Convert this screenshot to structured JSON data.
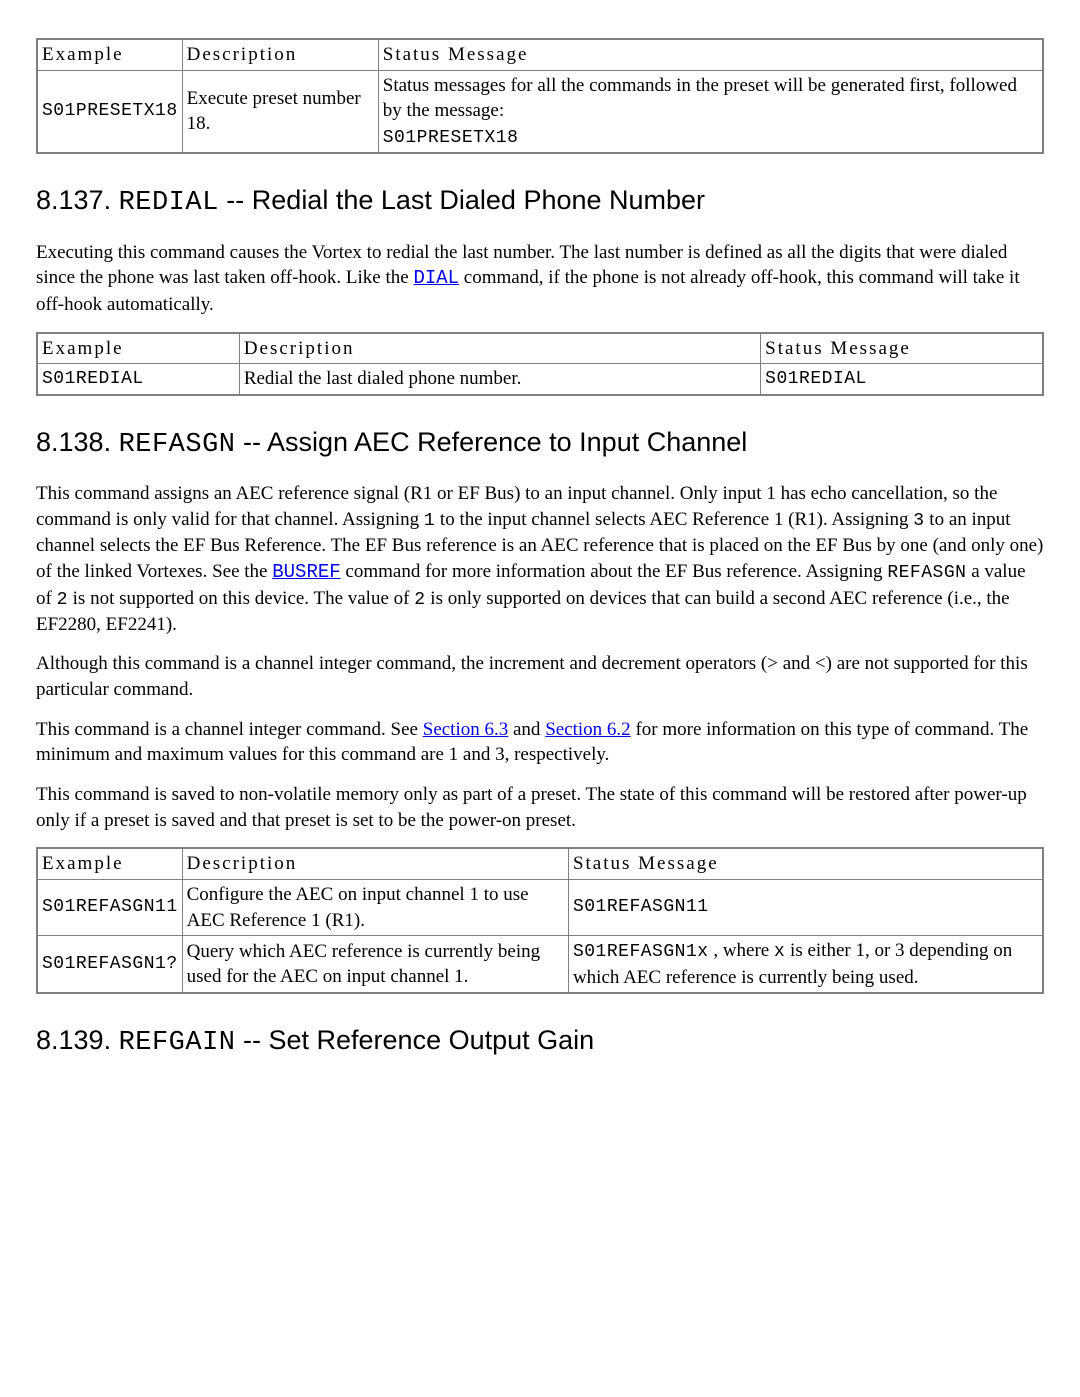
{
  "table0": {
    "headers": {
      "example": "Example",
      "description": "Description",
      "status": "Status Message"
    },
    "rows": [
      {
        "example": "S01PRESETX18",
        "description": "Execute preset number 18.",
        "status_prefix": "Status messages for all the commands in the preset will be generated first, followed by the message: ",
        "status_code": "S01PRESETX18"
      }
    ]
  },
  "section137": {
    "heading_num": "8.137. ",
    "heading_code": "REDIAL",
    "heading_rest": " -- Redial the Last Dialed Phone Number",
    "p1_a": "Executing this command causes the Vortex to redial the last number. The last number is defined as all the digits that were dialed since the phone was last taken off-hook. Like the ",
    "p1_link": "DIAL",
    "p1_b": " command, if the phone is not already off-hook, this command will take it off-hook automatically.",
    "table": {
      "headers": {
        "example": "Example",
        "description": "Description",
        "status": "Status Message"
      },
      "rows": [
        {
          "example": "S01REDIAL",
          "description": "Redial the last dialed phone number.",
          "status": "S01REDIAL"
        }
      ]
    }
  },
  "section138": {
    "heading_num": "8.138. ",
    "heading_code": "REFASGN",
    "heading_rest": " -- Assign AEC Reference to Input Channel",
    "p1_a": "This command assigns an AEC reference signal (R1 or EF Bus) to an input channel. Only input 1 has echo cancellation, so the command is only valid for that channel. Assigning ",
    "p1_code1": "1",
    "p1_b": " to the input channel selects AEC Reference 1 (R1). Assigning ",
    "p1_code2": "3",
    "p1_c": " to an input channel selects the EF Bus Reference. The EF Bus reference is an AEC reference that is placed on the EF Bus by one (and only one) of the linked Vortexes. See the ",
    "p1_link": "BUSREF",
    "p1_d": " command for more information about the EF Bus reference. Assigning ",
    "p1_code3": "REFASGN",
    "p1_e": " a value of ",
    "p1_code4": "2",
    "p1_f": " is not supported on this device. The value of ",
    "p1_code5": "2",
    "p1_g": " is only supported on devices that can build a second AEC reference (i.e., the EF2280, EF2241).",
    "p2": "Although this command is a channel integer command, the increment and decrement operators (> and <) are not supported for this particular command.",
    "p3_a": "This command is a channel integer command. See ",
    "p3_link1": "Section 6.3",
    "p3_b": " and ",
    "p3_link2": "Section 6.2",
    "p3_c": " for more information on this type of command. The minimum and maximum values for this command are 1 and 3, respectively.",
    "p4": "This command is saved to non-volatile memory only as part of a preset. The state of this command will be restored after power-up only if a preset is saved and that preset is set to be the power-on preset.",
    "table": {
      "headers": {
        "example": "Example",
        "description": "Description",
        "status": "Status Message"
      },
      "rows": [
        {
          "example": "S01REFASGN11",
          "description": "Configure the AEC on input channel 1 to use AEC Reference 1 (R1).",
          "status": "S01REFASGN11"
        },
        {
          "example": "S01REFASGN1?",
          "description": "Query which AEC reference is currently being used for the AEC on input channel 1.",
          "status_code": "S01REFASGN1x",
          "status_mid": " , where ",
          "status_code2": "x",
          "status_rest": " is either 1, or 3 depending on which AEC reference is currently being used."
        }
      ]
    }
  },
  "section139": {
    "heading_num": "8.139. ",
    "heading_code": "REFGAIN",
    "heading_rest": " -- Set Reference Output Gain"
  }
}
